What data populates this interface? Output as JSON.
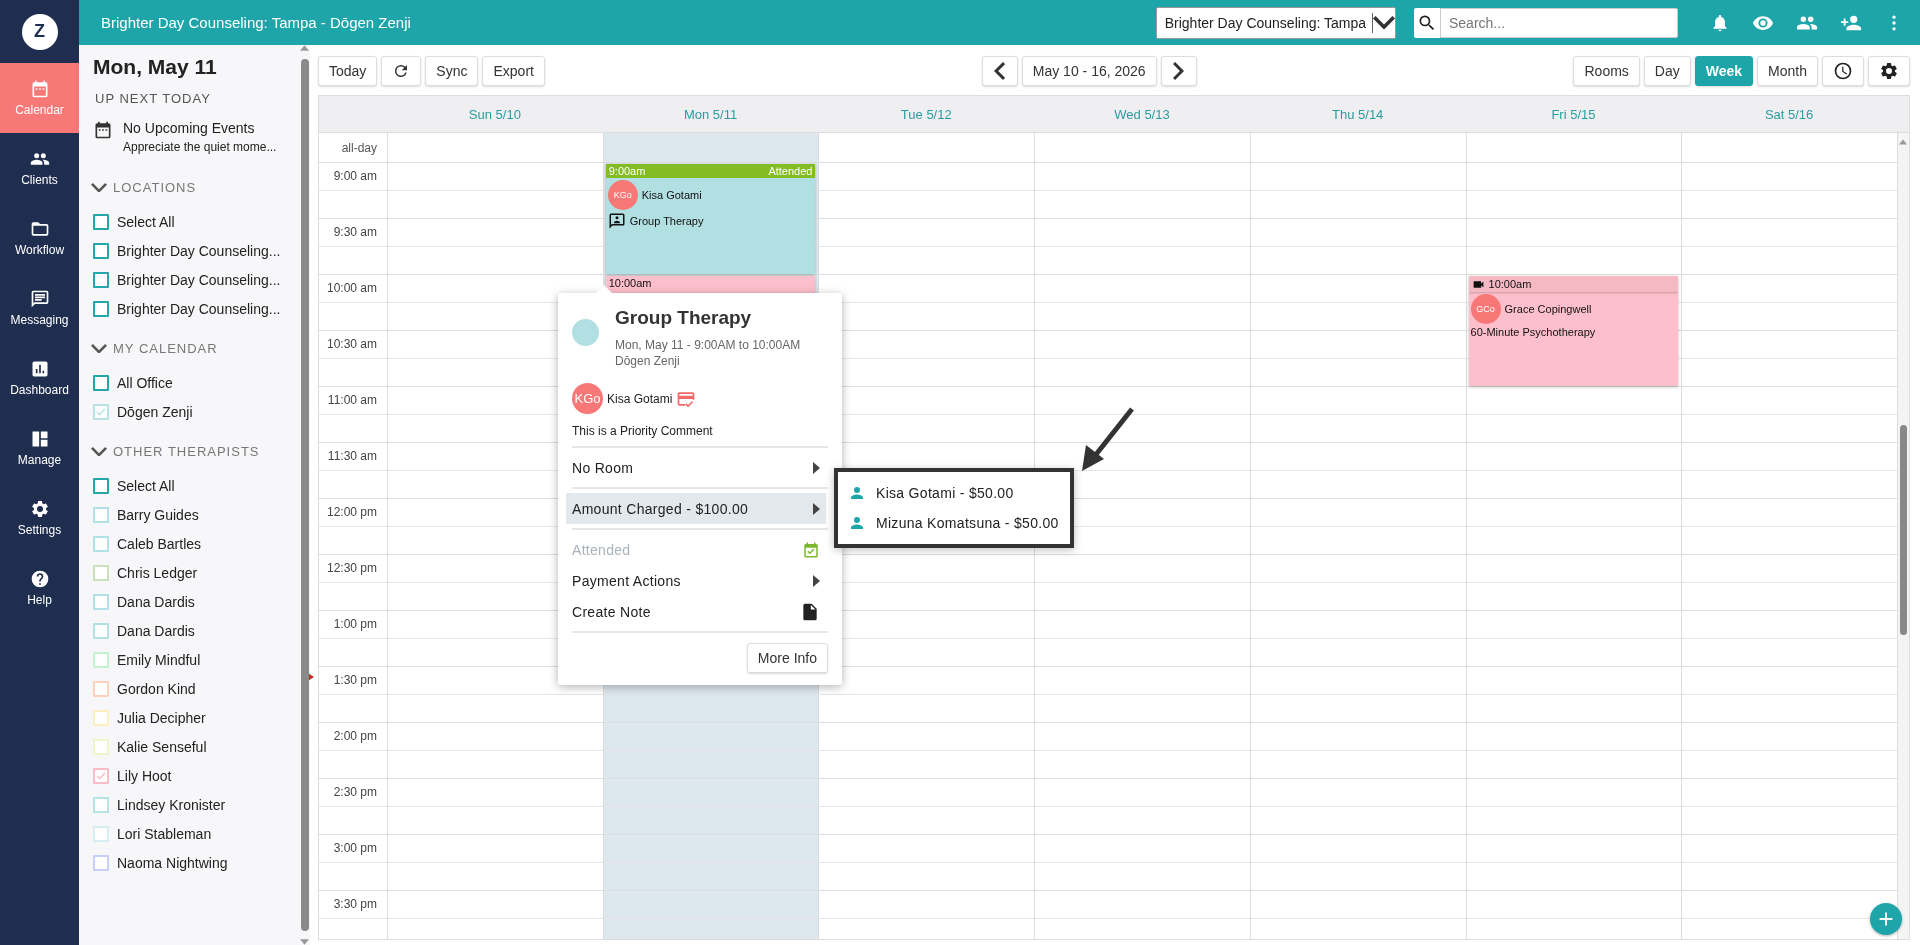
{
  "nav": {
    "logo": "Z",
    "items": [
      {
        "label": "Calendar",
        "selected": true
      },
      {
        "label": "Clients",
        "selected": false
      },
      {
        "label": "Workflow",
        "selected": false
      },
      {
        "label": "Messaging",
        "selected": false
      },
      {
        "label": "Dashboard",
        "selected": false
      },
      {
        "label": "Manage",
        "selected": false
      },
      {
        "label": "Settings",
        "selected": false
      },
      {
        "label": "Help",
        "selected": false
      }
    ]
  },
  "topbar": {
    "title": "Brighter Day Counseling: Tampa - Dōgen Zenji",
    "location_select": "Brighter Day Counseling: Tampa",
    "search": {
      "placeholder": "Search..."
    }
  },
  "sidebar": {
    "date": "Mon, May 11",
    "up_next": {
      "heading": "UP NEXT TODAY",
      "title": "No Upcoming Events",
      "subtitle": "Appreciate the quiet mome..."
    },
    "sections": [
      {
        "heading": "LOCATIONS",
        "expanded": true,
        "items": [
          {
            "label": "Select All",
            "checked": false,
            "color": "#26a6a8"
          },
          {
            "label": "Brighter Day Counseling...",
            "checked": false,
            "color": "#26a6a8"
          },
          {
            "label": "Brighter Day Counseling...",
            "checked": false,
            "color": "#26a6a8"
          },
          {
            "label": "Brighter Day Counseling...",
            "checked": false,
            "color": "#26a6a8"
          }
        ]
      },
      {
        "heading": "MY CALENDAR",
        "expanded": true,
        "items": [
          {
            "label": "All Office",
            "checked": false,
            "color": "#26a6a8"
          },
          {
            "label": "Dōgen Zenji",
            "checked": true,
            "color": "#b8e3e4"
          }
        ]
      },
      {
        "heading": "OTHER THERAPISTS",
        "expanded": true,
        "items": [
          {
            "label": "Select All",
            "checked": false,
            "color": "#26a6a8"
          },
          {
            "label": "Barry Guides",
            "checked": false,
            "color": "#b3e0e6"
          },
          {
            "label": "Caleb Bartles",
            "checked": false,
            "color": "#b3e0e6"
          },
          {
            "label": "Chris Ledger",
            "checked": false,
            "color": "#c8e0bc"
          },
          {
            "label": "Dana Dardis",
            "checked": false,
            "color": "#b3e0e6"
          },
          {
            "label": "Dana Dardis",
            "checked": false,
            "color": "#b3e0e6"
          },
          {
            "label": "Emily Mindful",
            "checked": false,
            "color": "#c2f2cf"
          },
          {
            "label": "Gordon Kind",
            "checked": false,
            "color": "#fdd2bd"
          },
          {
            "label": "Julia Decipher",
            "checked": false,
            "color": "#fbefc4"
          },
          {
            "label": "Kalie Senseful",
            "checked": false,
            "color": "#eaf7cc"
          },
          {
            "label": "Lily Hoot",
            "checked": true,
            "color": "#f8bcc6"
          },
          {
            "label": "Lindsey Kronister",
            "checked": false,
            "color": "#b5e2e3"
          },
          {
            "label": "Lori Stableman",
            "checked": false,
            "color": "#d9eef2"
          },
          {
            "label": "Naoma Nightwing",
            "checked": false,
            "color": "#c5cff7"
          }
        ]
      }
    ]
  },
  "toolbar": {
    "left": [
      {
        "label": "Today",
        "kind": "text"
      },
      {
        "kind": "refresh"
      },
      {
        "label": "Sync",
        "kind": "text"
      },
      {
        "label": "Export",
        "kind": "text"
      }
    ],
    "range": "May 10 - 16, 2026",
    "views": [
      {
        "label": "Rooms",
        "selected": false
      },
      {
        "label": "Day",
        "selected": false
      },
      {
        "label": "Week",
        "selected": true
      },
      {
        "label": "Month",
        "selected": false
      }
    ]
  },
  "calendar": {
    "all_day_label": "all-day",
    "days": [
      {
        "label": "Sun 5/10",
        "today": false
      },
      {
        "label": "Mon 5/11",
        "today": true,
        "events": [
          {
            "time": "9:00am",
            "status": "Attended",
            "initials": "KGo",
            "client": "Kisa Gotami",
            "service": "Group Therapy",
            "kind": "group",
            "color": "#b2dfe2"
          },
          {
            "time": "10:00am",
            "kind": "plain",
            "color": "#fdbfcb"
          }
        ]
      },
      {
        "label": "Tue 5/12",
        "today": false
      },
      {
        "label": "Wed 5/13",
        "today": false
      },
      {
        "label": "Thu 5/14",
        "today": false
      },
      {
        "label": "Fri 5/15",
        "today": false,
        "events": [
          {
            "time": "10:00am",
            "initials": "GCo",
            "client": "Grace Copingwell",
            "service": "60-Minute Psychotherapy",
            "kind": "video",
            "color": "#fdbfcb"
          }
        ]
      },
      {
        "label": "Sat 5/16",
        "today": false
      }
    ],
    "times": [
      "9:00 am",
      "9:30 am",
      "10:00 am",
      "10:30 am",
      "11:00 am",
      "11:30 am",
      "12:00 pm",
      "12:30 pm",
      "1:00 pm",
      "1:30 pm",
      "2:00 pm",
      "2:30 pm",
      "3:00 pm",
      "3:30 pm"
    ]
  },
  "popup": {
    "color": "#b2dfe2",
    "title": "Group Therapy",
    "when": "Mon, May 11 - 9:00AM to 10:00AM",
    "provider": "Dōgen Zenji",
    "client": {
      "initials": "KGo",
      "name": "Kisa Gotami"
    },
    "comment": "This is a Priority Comment",
    "menu": [
      {
        "label": "No Room",
        "kind": "submenu",
        "selected": false,
        "disabled": false
      },
      {
        "label": "Amount Charged - $100.00",
        "kind": "submenu",
        "selected": true,
        "disabled": false
      },
      {
        "label": "Attended",
        "kind": "attended",
        "selected": false,
        "disabled": true
      },
      {
        "label": "Payment Actions",
        "kind": "submenu",
        "selected": false,
        "disabled": false
      },
      {
        "label": "Create Note",
        "kind": "note",
        "selected": false,
        "disabled": false
      }
    ],
    "button": "More Info",
    "submenu": [
      {
        "label": "Kisa Gotami - $50.00"
      },
      {
        "label": "Mizuna Komatsuna - $50.00"
      }
    ]
  }
}
